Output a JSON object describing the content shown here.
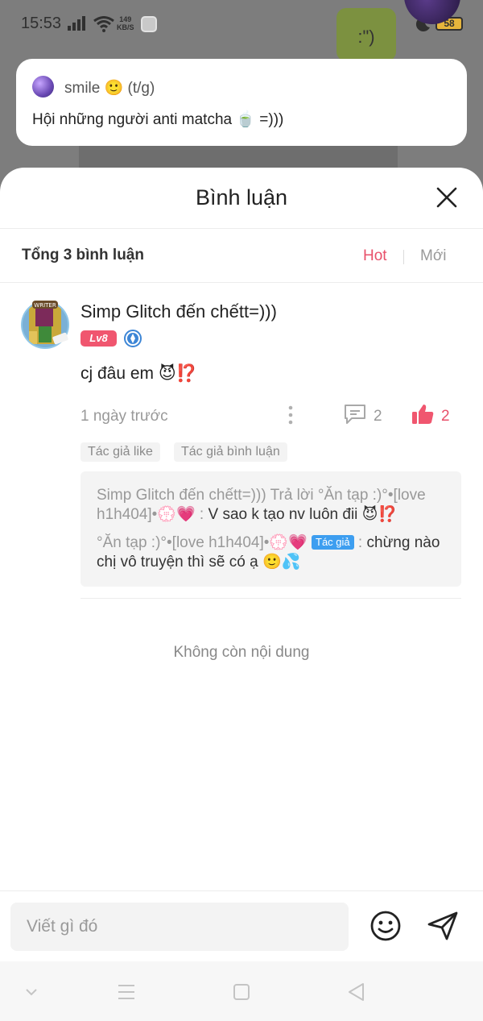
{
  "status_bar": {
    "time": "15:53",
    "net_speed_value": "149",
    "net_speed_unit": "KB/S",
    "battery": "58"
  },
  "background": {
    "sticker_text": ":\")"
  },
  "notification": {
    "title": "smile 🙂 (t/g)",
    "body": "Hội những người anti matcha 🍵 =)))"
  },
  "sheet": {
    "title": "Bình luận",
    "total": "Tổng 3 bình luận",
    "sort_hot": "Hot",
    "sort_new": "Mới",
    "accent_color": "#e8506a"
  },
  "comment": {
    "name": "Simp Glitch đến chếtt=)))",
    "level": "Lv8",
    "text": "cj đâu em 😈⁉️",
    "time": "1 ngày trước",
    "reply_count": "2",
    "like_count": "2",
    "tags": [
      "Tác giả like",
      "Tác giả bình luận"
    ],
    "replies": [
      {
        "author": "Simp Glitch đến chếtt=)))",
        "verb": "Trả lời",
        "target": "°Ăn tạp :)°•[love h1h404]•💮💗",
        "separator": " : ",
        "text": "V sao k tạo nv luôn đii 😈⁉️"
      },
      {
        "author": "°Ăn tạp :)°•[love h1h404]•💮💗",
        "badge": "Tác giả",
        "separator": " : ",
        "text": "chừng nào chị vô truyện thì sẽ có ạ 🙂💦"
      }
    ]
  },
  "end_of_content": "Không còn nội dung",
  "composer": {
    "placeholder": "Viết gì đó"
  }
}
